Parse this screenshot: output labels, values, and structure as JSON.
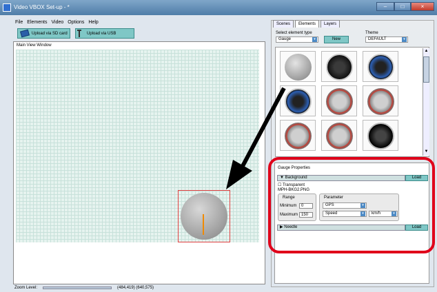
{
  "window": {
    "title": "Video VBOX Set-up - *",
    "controls": {
      "minimize": "–",
      "maximize": "□",
      "close": "×"
    }
  },
  "menu": [
    "File",
    "Elements",
    "Video",
    "Options",
    "Help"
  ],
  "toolbar": {
    "upload_sd_label": "Upload via SD card",
    "upload_usb_label": "Upload via USB"
  },
  "main_view": {
    "title": "Main View Window"
  },
  "status": {
    "zoom_label": "Zoom Level:",
    "coords": "(484,419) (640,575)"
  },
  "tabs": [
    {
      "label": "Scenes",
      "active": false
    },
    {
      "label": "Elements",
      "active": true
    },
    {
      "label": "Layers",
      "active": false
    }
  ],
  "element_select": {
    "label": "Select element type",
    "value": "Gauge",
    "new_label": "New"
  },
  "theme": {
    "label": "Theme",
    "value": "DEFAULT"
  },
  "thumbnails": [
    {
      "style": "gray"
    },
    {
      "style": "dark"
    },
    {
      "style": "blue"
    },
    {
      "style": "blue"
    },
    {
      "style": "red"
    },
    {
      "style": "red"
    },
    {
      "style": "red"
    },
    {
      "style": "red"
    },
    {
      "style": "black"
    }
  ],
  "gauge_properties": {
    "title": "Gauge Properties",
    "background": {
      "header": "Background",
      "load_label": "Load",
      "transparent_label": "Transparent",
      "filename": "MPH-BKG2.PNG",
      "range": {
        "title": "Range",
        "minimum_label": "Minimum",
        "minimum_value": "0",
        "maximum_label": "Maximum",
        "maximum_value": "150"
      },
      "parameter": {
        "title": "Parameter",
        "source": "GPS",
        "channel": "Speed",
        "unit": "km/h"
      }
    },
    "needle": {
      "header": "Needle",
      "load_label": "Load"
    }
  },
  "colors": {
    "accent_teal": "#7fc7c6",
    "highlight_red": "#e0001a",
    "needle_orange": "#f08a00"
  }
}
